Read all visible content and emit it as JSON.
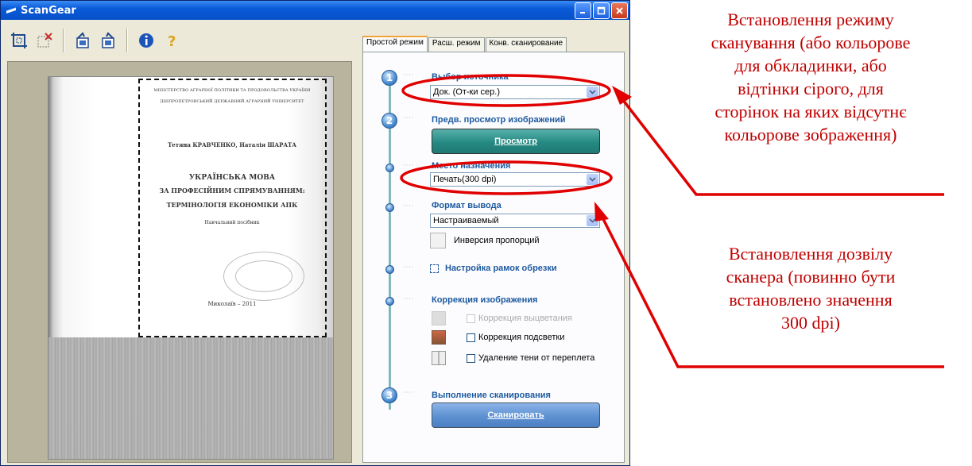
{
  "window": {
    "title": "ScanGear"
  },
  "tabs": [
    {
      "label": "Простой режим",
      "active": true
    },
    {
      "label": "Расш. режим",
      "active": false
    },
    {
      "label": "Конв. сканирование",
      "active": false
    }
  ],
  "steps": {
    "source": {
      "number": "1",
      "label": "Выбор источника",
      "value": "Док. (От-ки сер.)"
    },
    "preview": {
      "number": "2",
      "label": "Предв. просмотр изображений",
      "button": "Просмотр"
    },
    "destination": {
      "label": "Место назначения",
      "value": "Печать(300 dpi)"
    },
    "output": {
      "label": "Формат вывода",
      "value": "Настраиваемый",
      "swap_label": "Инверсия пропорций"
    },
    "crop": {
      "label": "Настройка рамок обрезки"
    },
    "correction": {
      "label": "Коррекция изображения",
      "items": [
        {
          "label": "Коррекция выцветания",
          "checked": false,
          "enabled": false
        },
        {
          "label": "Коррекция подсветки",
          "checked": false,
          "enabled": true
        },
        {
          "label": "Удаление тени от переплета",
          "checked": false,
          "enabled": true
        }
      ]
    },
    "scan": {
      "number": "3",
      "label": "Выполнение сканирования",
      "button": "Сканировать"
    }
  },
  "preview_doc": {
    "header1": "МІНІСТЕРСТВО АГРАРНОЇ ПОЛІТИКИ ТА ПРОДОВОЛЬСТВА УКРАЇНИ",
    "header2": "ДНІПРОПЕТРОВСЬКИЙ ДЕРЖАВНИЙ АГРАРНИЙ УНІВЕРСИТЕТ",
    "authors": "Тетяна КРАВЧЕНКО, Наталія ШАРАТА",
    "title1": "УКРАЇНСЬКА МОВА",
    "title2": "ЗА ПРОФЕСІЙНИМ СПРЯМУВАННЯМ:",
    "title3": "ТЕРМІНОЛОГІЯ ЕКОНОМІКИ АПК",
    "subtitle": "Навчальний посібник",
    "city": "Миколаїв – 2011"
  },
  "annotations": {
    "top": "Встановлення режиму сканування (або кольорове для обкладинки, або відтінки сірого, для сторінок на яких відсутнє кольорове зображення)",
    "top_lines": [
      "Встановлення режиму",
      "сканування (або кольорове",
      "для обкладинки, або",
      "відтінки сірого, для",
      "сторінок на яких відсутнє",
      "кольорове зображення)"
    ],
    "bottom_lines": [
      "Встановлення дозвілу",
      "сканера (повинно бути",
      "встановлено значення",
      "300 dpi)"
    ]
  },
  "colors": {
    "annotation": "#cc0000",
    "title_bar": "#0a5ad8",
    "step_label": "#1d5aa0"
  }
}
